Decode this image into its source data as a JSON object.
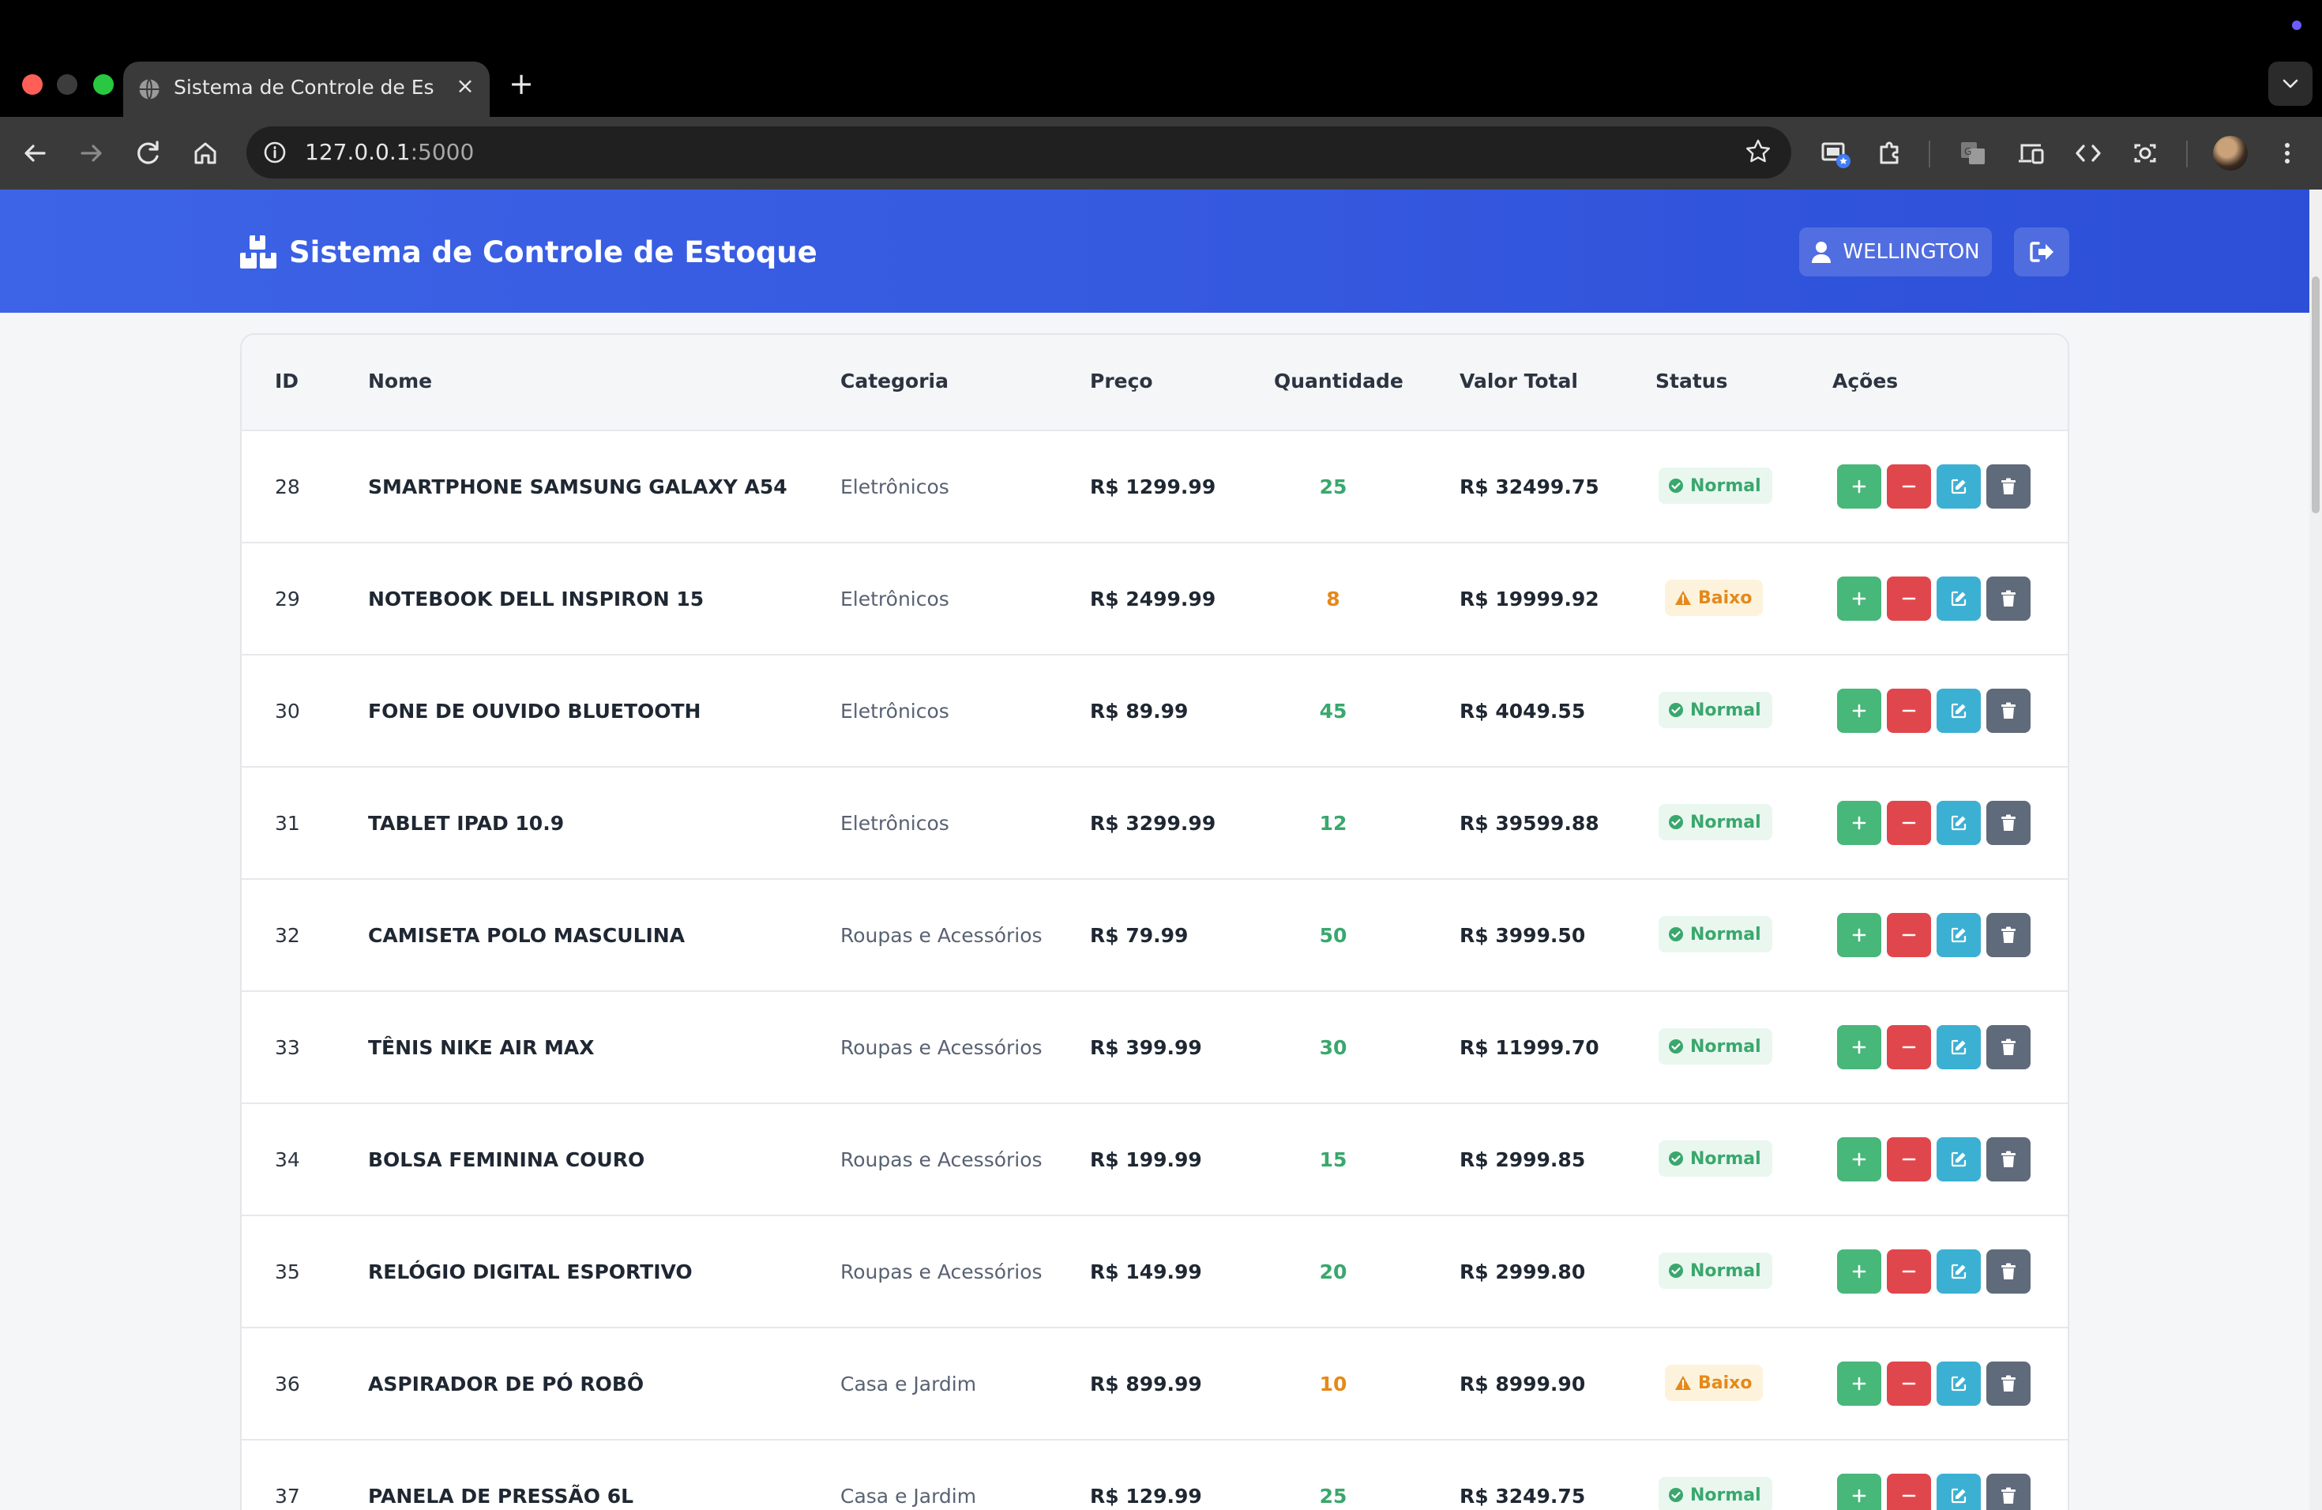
{
  "browser": {
    "tab_title": "Sistema de Controle de Estoque",
    "url_host": "127.0.0.1",
    "url_port": ":5000"
  },
  "header": {
    "title": "Sistema de Controle de Estoque",
    "user_name": "WELLINGTON"
  },
  "table": {
    "columns": [
      "ID",
      "Nome",
      "Categoria",
      "Preço",
      "Quantidade",
      "Valor Total",
      "Status",
      "Ações"
    ],
    "rows": [
      {
        "id": "28",
        "name": "SMARTPHONE SAMSUNG GALAXY A54",
        "category": "Eletrônicos",
        "price": "R$ 1299.99",
        "qty": "25",
        "total": "R$ 32499.75",
        "status": "Normal"
      },
      {
        "id": "29",
        "name": "NOTEBOOK DELL INSPIRON 15",
        "category": "Eletrônicos",
        "price": "R$ 2499.99",
        "qty": "8",
        "total": "R$ 19999.92",
        "status": "Baixo"
      },
      {
        "id": "30",
        "name": "FONE DE OUVIDO BLUETOOTH",
        "category": "Eletrônicos",
        "price": "R$ 89.99",
        "qty": "45",
        "total": "R$ 4049.55",
        "status": "Normal"
      },
      {
        "id": "31",
        "name": "TABLET IPAD 10.9",
        "category": "Eletrônicos",
        "price": "R$ 3299.99",
        "qty": "12",
        "total": "R$ 39599.88",
        "status": "Normal"
      },
      {
        "id": "32",
        "name": "CAMISETA POLO MASCULINA",
        "category": "Roupas e Acessórios",
        "price": "R$ 79.99",
        "qty": "50",
        "total": "R$ 3999.50",
        "status": "Normal"
      },
      {
        "id": "33",
        "name": "TÊNIS NIKE AIR MAX",
        "category": "Roupas e Acessórios",
        "price": "R$ 399.99",
        "qty": "30",
        "total": "R$ 11999.70",
        "status": "Normal"
      },
      {
        "id": "34",
        "name": "BOLSA FEMININA COURO",
        "category": "Roupas e Acessórios",
        "price": "R$ 199.99",
        "qty": "15",
        "total": "R$ 2999.85",
        "status": "Normal"
      },
      {
        "id": "35",
        "name": "RELÓGIO DIGITAL ESPORTIVO",
        "category": "Roupas e Acessórios",
        "price": "R$ 149.99",
        "qty": "20",
        "total": "R$ 2999.80",
        "status": "Normal"
      },
      {
        "id": "36",
        "name": "ASPIRADOR DE PÓ ROBÔ",
        "category": "Casa e Jardim",
        "price": "R$ 899.99",
        "qty": "10",
        "total": "R$ 8999.90",
        "status": "Baixo"
      },
      {
        "id": "37",
        "name": "PANELA DE PRESSÃO 6L",
        "category": "Casa e Jardim",
        "price": "R$ 129.99",
        "qty": "25",
        "total": "R$ 3249.75",
        "status": "Normal"
      }
    ]
  },
  "colors": {
    "header_blue": "#3d63e6",
    "normal_green": "#3aa76d",
    "low_orange": "#e5891a",
    "add_button": "#48b77a",
    "remove_button": "#e0474c",
    "edit_button": "#3bb0d3",
    "delete_button": "#5f6b7a"
  }
}
